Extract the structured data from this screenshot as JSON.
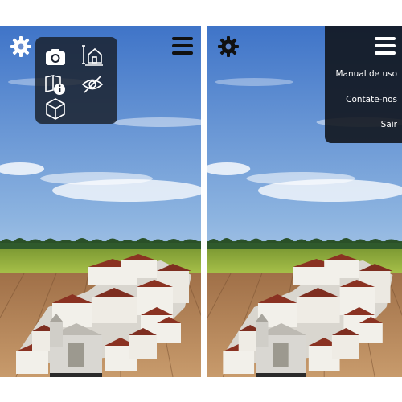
{
  "colors": {
    "sky_top": "#4a7fd0",
    "sky_bottom": "#d6e6f4",
    "grass": "#94b23c",
    "deck": "#b98b5c",
    "roof": "#8a3222",
    "wall": "#f2f0ea",
    "menu_bg": "#12161e"
  },
  "left_screen": {
    "settings_icon": "gear-icon",
    "menu_icon": "hamburger-menu-icon",
    "tools_menu": {
      "items": [
        {
          "icon": "camera-icon"
        },
        {
          "icon": "measure-house-icon"
        },
        {
          "icon": "book-info-icon"
        },
        {
          "icon": "eye-off-icon"
        },
        {
          "icon": "cube-icon"
        }
      ]
    }
  },
  "right_screen": {
    "settings_icon": "gear-icon",
    "menu_icon": "hamburger-menu-icon",
    "main_menu": {
      "items": [
        "Manual de uso",
        "Contate-nos",
        "Sair"
      ]
    }
  }
}
